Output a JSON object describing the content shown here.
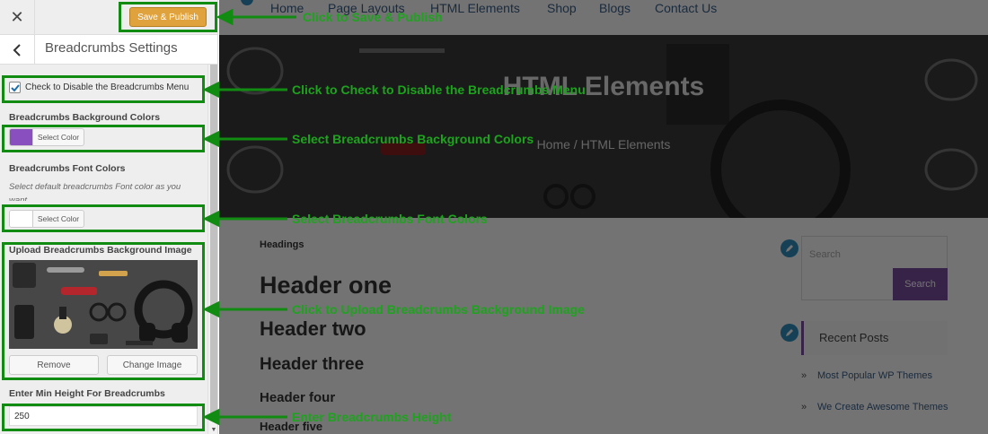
{
  "customizer": {
    "close_glyph": "✕",
    "publish_label": "Save & Publish",
    "section_title": "Breadcrumbs Settings",
    "disable_checkbox_label": "Check to Disable the Breadcrumbs Menu",
    "disable_checked": true,
    "bg_colors_label": "Breadcrumbs Background Colors",
    "bg_color_value": "#8a4fbf",
    "select_color_label": "Select Color",
    "font_colors_label": "Breadcrumbs Font Colors",
    "font_colors_desc": "Select default breadcrumbs Font color as you want",
    "font_color_value": "#ffffff",
    "upload_label": "Upload Breadcrumbs Background Image",
    "remove_label": "Remove",
    "change_image_label": "Change Image",
    "min_height_label": "Enter Min Height For Breadcrumbs",
    "min_height_value": "250"
  },
  "preview": {
    "nav": [
      "Home",
      "Page Layouts",
      "HTML Elements",
      "Shop",
      "Blogs",
      "Contact Us"
    ],
    "hero_title": "HTML Elements",
    "hero_breadcrumb": "Home / HTML Elements",
    "headings_label": "Headings",
    "headings": [
      "Header one",
      "Header two",
      "Header three",
      "Header four",
      "Header five"
    ],
    "search_placeholder": "Search",
    "search_button": "Search",
    "recent_posts_title": "Recent Posts",
    "recent_posts": [
      "Most Popular WP Themes",
      "We Create Awesome Themes"
    ],
    "bullet": "»"
  },
  "annotations": {
    "publish": "Click to Save & Publish",
    "disable": "Click to Check to Disable the Breadcrumbs Menu",
    "bg_color": "Select Breadcrumbs Background Colors",
    "font_color": "Select Breadcrumbs Font Colors",
    "upload": "Click to Upload Breadcrumbs Background Image",
    "height": "Enter Breadcrumbs Height"
  },
  "colors": {
    "accent_green": "#128b12",
    "publish_orange": "#e0a23c",
    "purple": "#7b4fa0"
  }
}
